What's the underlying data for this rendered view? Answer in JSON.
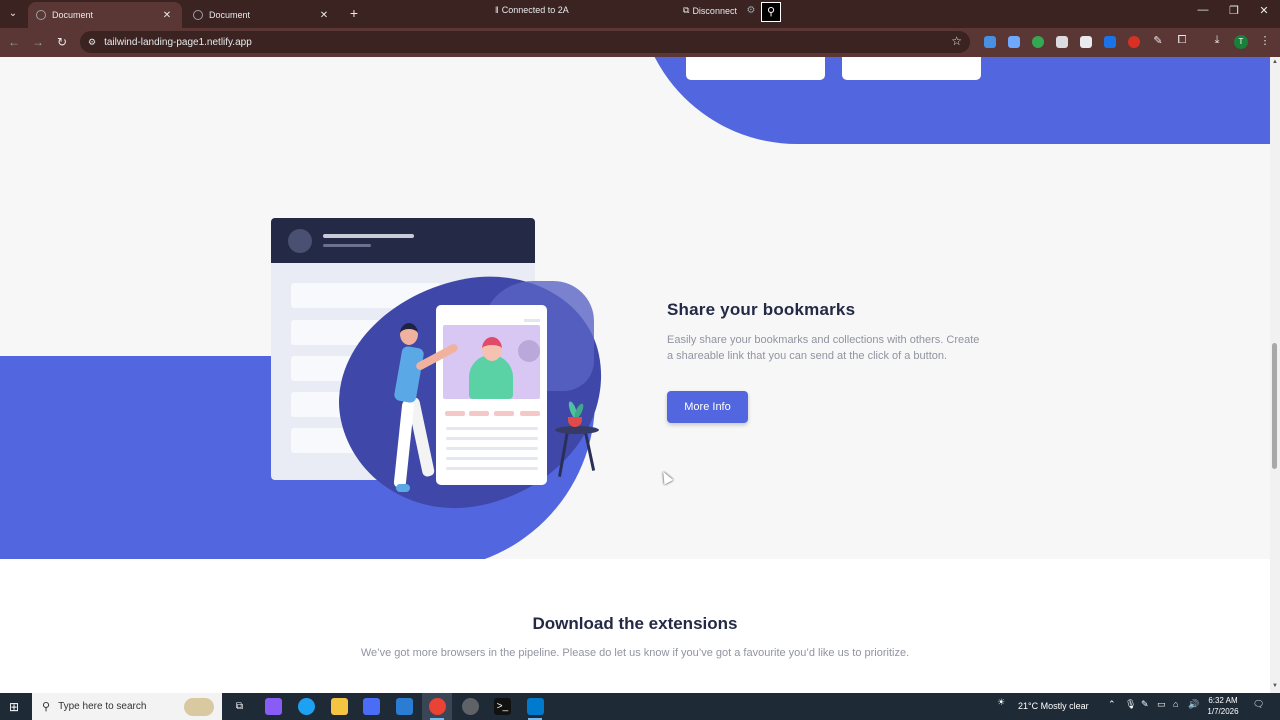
{
  "browser": {
    "tabs": [
      {
        "title": "Document",
        "active": true
      },
      {
        "title": "Document",
        "active": false
      }
    ],
    "remote_status": "Connected to 2A",
    "disconnect_label": "Disconnect",
    "url": "tailwind-landing-page1.netlify.app",
    "profile_initial": "T"
  },
  "page": {
    "feature": {
      "title": "Share your bookmarks",
      "description": "Easily share your bookmarks and collections with others. Create a shareable link that you can send at the click of a button.",
      "button_label": "More Info"
    },
    "download": {
      "title": "Download the extensions",
      "subtitle": "We’ve got more browsers in the pipeline. Please do let us know if you’ve got a favourite you’d like us to prioritize."
    },
    "colors": {
      "accent": "#5267df",
      "dark": "#242a45",
      "muted": "#9194a1"
    }
  },
  "taskbar": {
    "search_placeholder": "Type here to search",
    "weather": "21°C  Mostly clear",
    "time": "6:32 AM",
    "date": "1/7/2026"
  }
}
